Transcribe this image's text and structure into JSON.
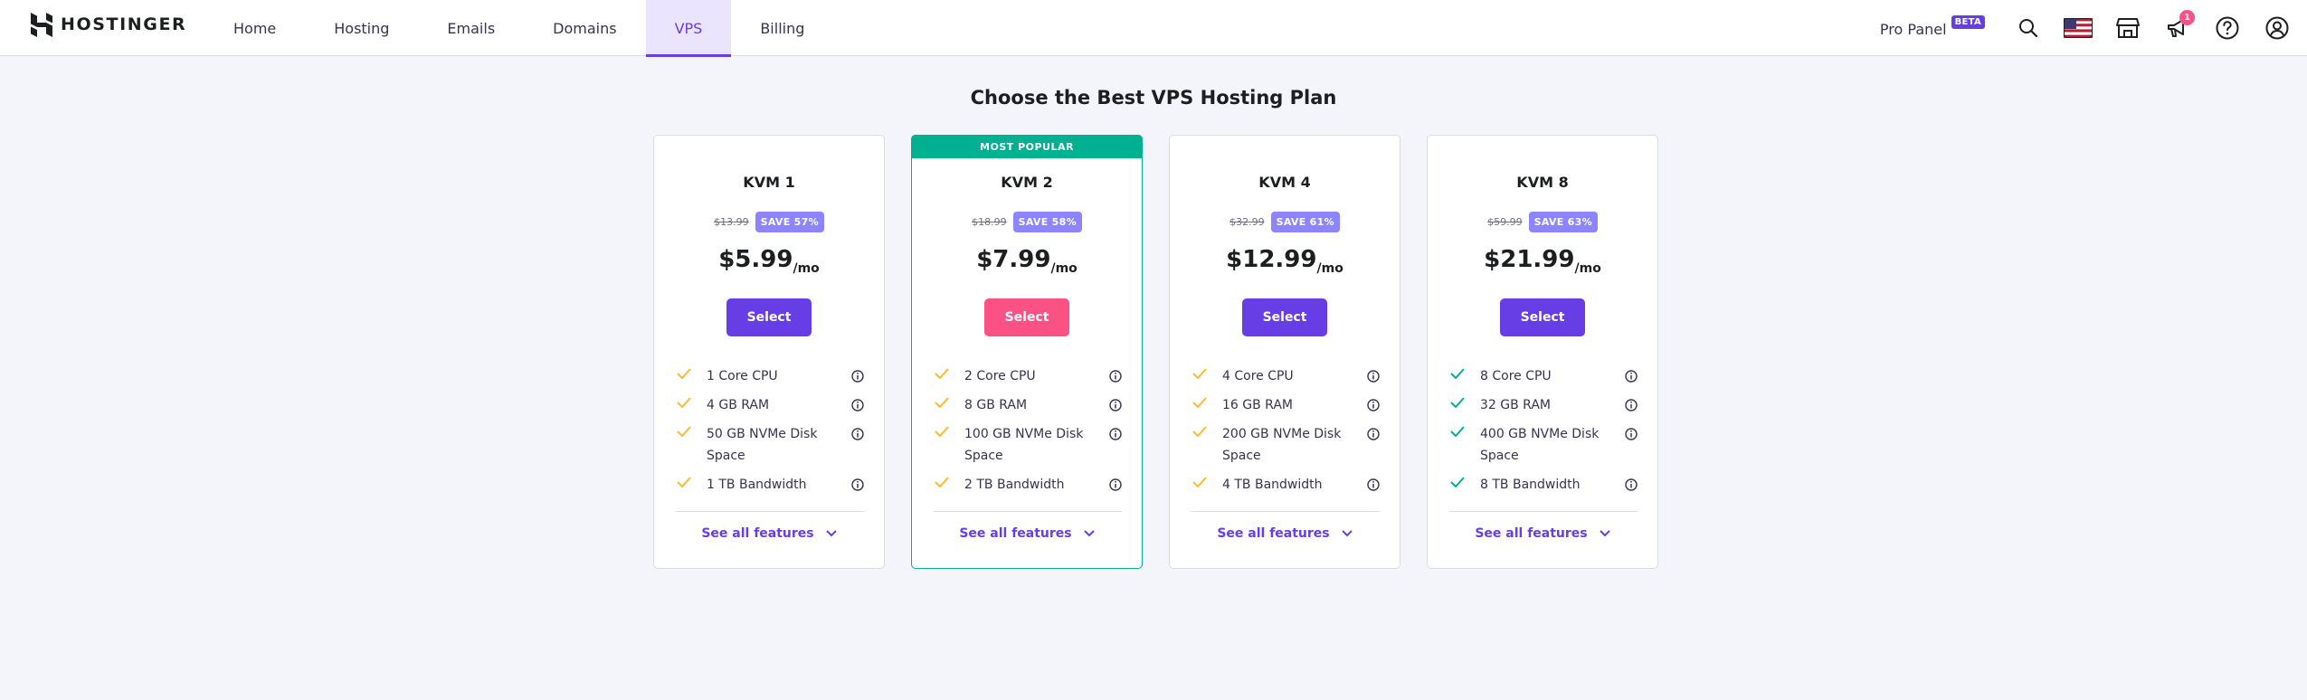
{
  "brand": {
    "name": "HOSTINGER",
    "accent": "#673de6",
    "popular_color": "#00b090",
    "pink": "#fc5185"
  },
  "nav": {
    "items": [
      {
        "label": "Home",
        "active": false
      },
      {
        "label": "Hosting",
        "active": false
      },
      {
        "label": "Emails",
        "active": false
      },
      {
        "label": "Domains",
        "active": false
      },
      {
        "label": "VPS",
        "active": true
      },
      {
        "label": "Billing",
        "active": false
      }
    ]
  },
  "toolbar": {
    "pro_panel_label": "Pro Panel",
    "beta_label": "BETA",
    "notification_count": "1",
    "icons": [
      "search-icon",
      "us-flag-icon",
      "store-icon",
      "megaphone-icon",
      "help-icon",
      "account-icon"
    ]
  },
  "main": {
    "heading": "Choose the Best VPS Hosting Plan",
    "see_all_label": "See all features",
    "select_label": "Select",
    "popular_label": "MOST POPULAR",
    "plans": [
      {
        "name": "KVM 1",
        "old_price": "$13.99",
        "save": "SAVE 57%",
        "price": "$5.99",
        "unit": "/mo",
        "popular": false,
        "check_color": "#ffb92d",
        "features": [
          "1 Core CPU",
          "4 GB RAM",
          "50 GB NVMe Disk Space",
          "1 TB Bandwidth"
        ]
      },
      {
        "name": "KVM 2",
        "old_price": "$18.99",
        "save": "SAVE 58%",
        "price": "$7.99",
        "unit": "/mo",
        "popular": true,
        "check_color": "#ffb92d",
        "features": [
          "2 Core CPU",
          "8 GB RAM",
          "100 GB NVMe Disk Space",
          "2 TB Bandwidth"
        ]
      },
      {
        "name": "KVM 4",
        "old_price": "$32.99",
        "save": "SAVE 61%",
        "price": "$12.99",
        "unit": "/mo",
        "popular": false,
        "check_color": "#ffb92d",
        "features": [
          "4 Core CPU",
          "16 GB RAM",
          "200 GB NVMe Disk Space",
          "4 TB Bandwidth"
        ]
      },
      {
        "name": "KVM 8",
        "old_price": "$59.99",
        "save": "SAVE 63%",
        "price": "$21.99",
        "unit": "/mo",
        "popular": false,
        "check_color": "#00b090",
        "features": [
          "8 Core CPU",
          "32 GB RAM",
          "400 GB NVMe Disk Space",
          "8 TB Bandwidth"
        ]
      }
    ]
  }
}
